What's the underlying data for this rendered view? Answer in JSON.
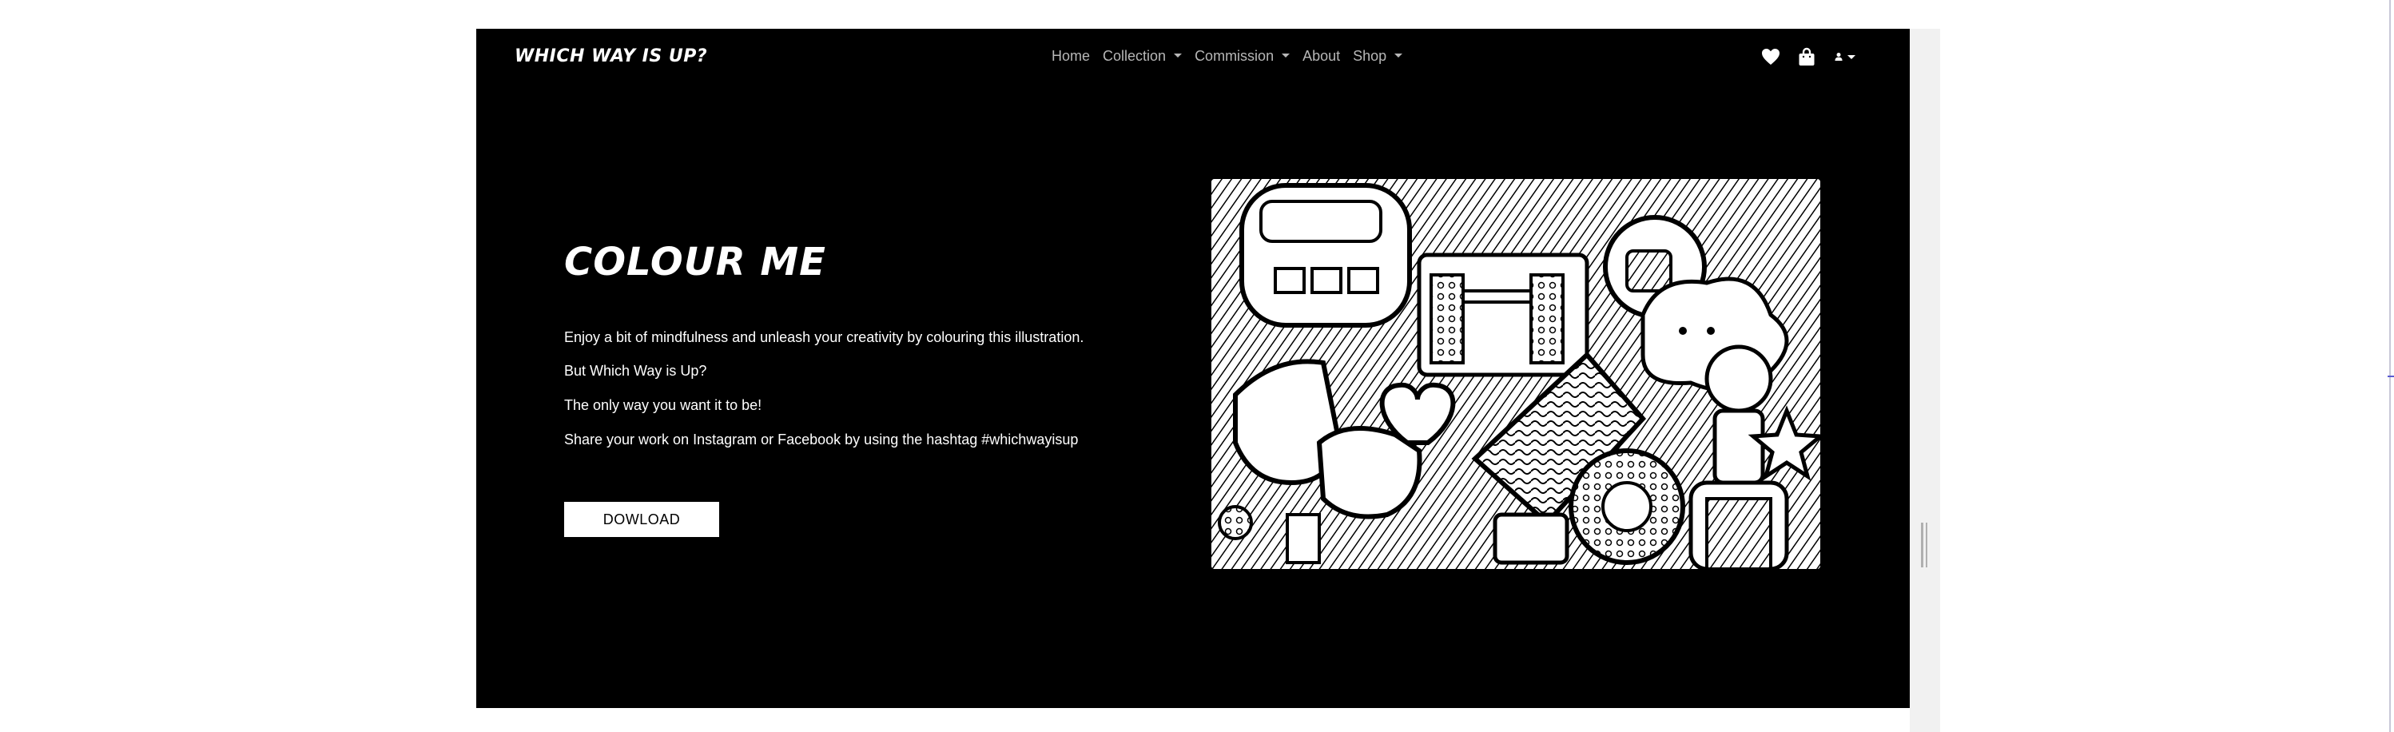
{
  "navbar": {
    "brand": "WHICH WAY IS UP?",
    "links": [
      {
        "label": "Home",
        "dropdown": false
      },
      {
        "label": "Collection",
        "dropdown": true
      },
      {
        "label": "Commission",
        "dropdown": true
      },
      {
        "label": "About",
        "dropdown": false
      },
      {
        "label": "Shop",
        "dropdown": true
      }
    ],
    "icons": [
      "heart-icon",
      "shopping-bag-icon",
      "user-icon"
    ]
  },
  "hero": {
    "title": "COLOUR ME",
    "paragraphs": [
      "Enjoy a bit of mindfulness and unleash your creativity by colouring this illustration.",
      "But Which Way is Up?",
      "The only way you want it to be!",
      "Share your work on Instagram or Facebook by using the hashtag #whichwayisup"
    ],
    "button_label": "DOWLOAD"
  },
  "colors": {
    "hero_bg": "#000000",
    "nav_text": "#b7b7b7",
    "text": "#ffffff"
  }
}
